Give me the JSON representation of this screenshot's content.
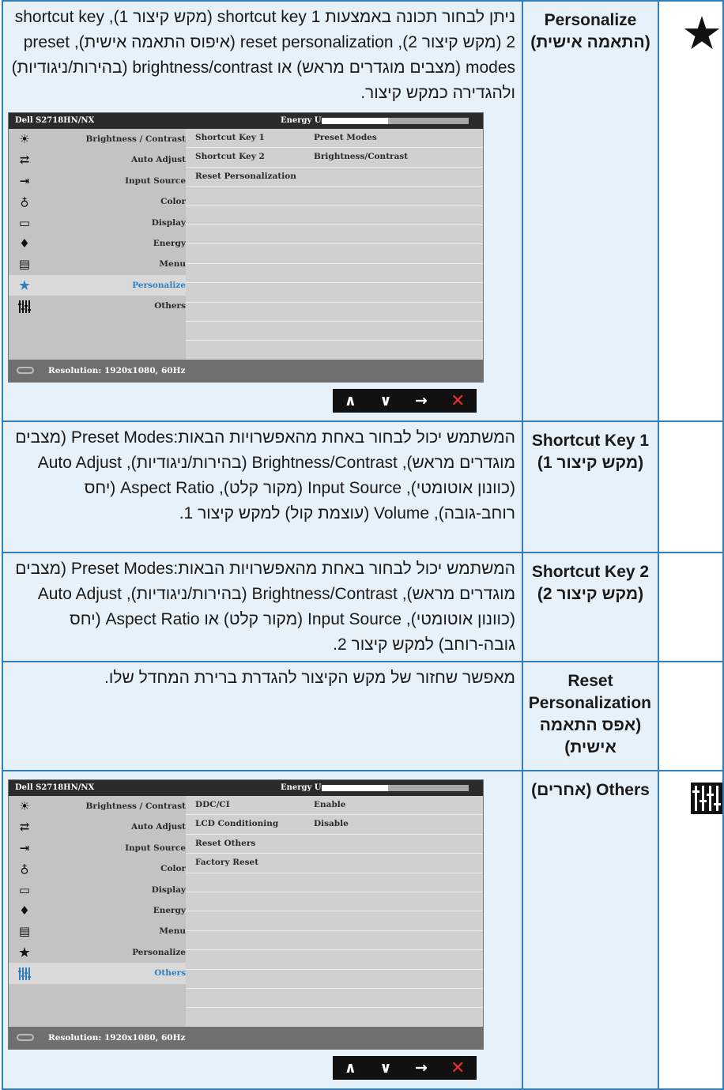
{
  "rows": [
    {
      "name": "Personalize\n(התאמה אישית)",
      "desc": "ניתן לבחור תכונה באמצעות shortcut key 1 (מקש קיצור 1), shortcut key 2 (מקש קיצור 2), reset personalization (איפוס התאמה אישית), preset modes (מצבים מוגדרים מראש) או brightness/contrast (בהירות/ניגודיות) ולהגדירה כמקש קיצור.",
      "icon": "star-icon"
    },
    {
      "name": "Shortcut Key 1\n(מקש קיצור 1)",
      "desc": "המשתמש יכול לבחור באחת מהאפשרויות הבאות:Preset Modes (מצבים מוגדרים מראש), Brightness/Contrast (בהירות/ניגודיות), Auto Adjust (כוונון אוטומטי), Input Source (מקור קלט), Aspect Ratio (יחס רוחב-גובה), Volume (עוצמת קול) למקש קיצור 1."
    },
    {
      "name": "Shortcut Key 2\n(מקש קיצור 2)",
      "desc": "המשתמש יכול לבחור באחת מהאפשרויות הבאות:Preset Modes (מצבים מוגדרים מראש), Brightness/Contrast (בהירות/ניגודיות), Auto Adjust (כוונון אוטומטי), Input Source (מקור קלט) או Aspect Ratio (יחס גובה-רוחב) למקש קיצור 2."
    },
    {
      "name": "Reset Personalization\n(אפס התאמה אישית)",
      "desc": "מאפשר שחזור של מקש הקיצור להגדרת ברירת המחדל שלו."
    },
    {
      "name": "Others (אחרים)",
      "icon": "others-equalizer-icon"
    }
  ],
  "osd": {
    "model": "Dell S2718HN/NX",
    "energy_label": "Energy Use",
    "energy_level": 0.45,
    "resolution": "Resolution: 1920x1080, 60Hz",
    "menu": [
      {
        "label": "Brightness / Contrast",
        "icon": "brightness-icon"
      },
      {
        "label": "Auto Adjust",
        "icon": "auto-adjust-icon"
      },
      {
        "label": "Input Source",
        "icon": "input-source-icon"
      },
      {
        "label": "Color",
        "icon": "color-icon"
      },
      {
        "label": "Display",
        "icon": "display-icon"
      },
      {
        "label": "Energy",
        "icon": "energy-icon"
      },
      {
        "label": "Menu",
        "icon": "menu-icon"
      },
      {
        "label": "Personalize",
        "icon": "star-icon"
      },
      {
        "label": "Others",
        "icon": "others-equalizer-icon"
      }
    ],
    "personalize_sub": [
      {
        "label": "Shortcut Key 1",
        "value": "Preset Modes"
      },
      {
        "label": "Shortcut Key 2",
        "value": "Brightness/Contrast"
      },
      {
        "label": "Reset Personalization",
        "value": ""
      }
    ],
    "others_sub": [
      {
        "label": "DDC/CI",
        "value": "Enable"
      },
      {
        "label": "LCD Conditioning",
        "value": "Disable"
      },
      {
        "label": "Reset Others",
        "value": ""
      },
      {
        "label": "Factory Reset",
        "value": ""
      }
    ],
    "nav": {
      "up": "∧",
      "down": "∨",
      "enter": "→",
      "exit": "✕"
    },
    "colors": {
      "accent": "#2f7fbf",
      "exit": "#e8312f"
    }
  }
}
